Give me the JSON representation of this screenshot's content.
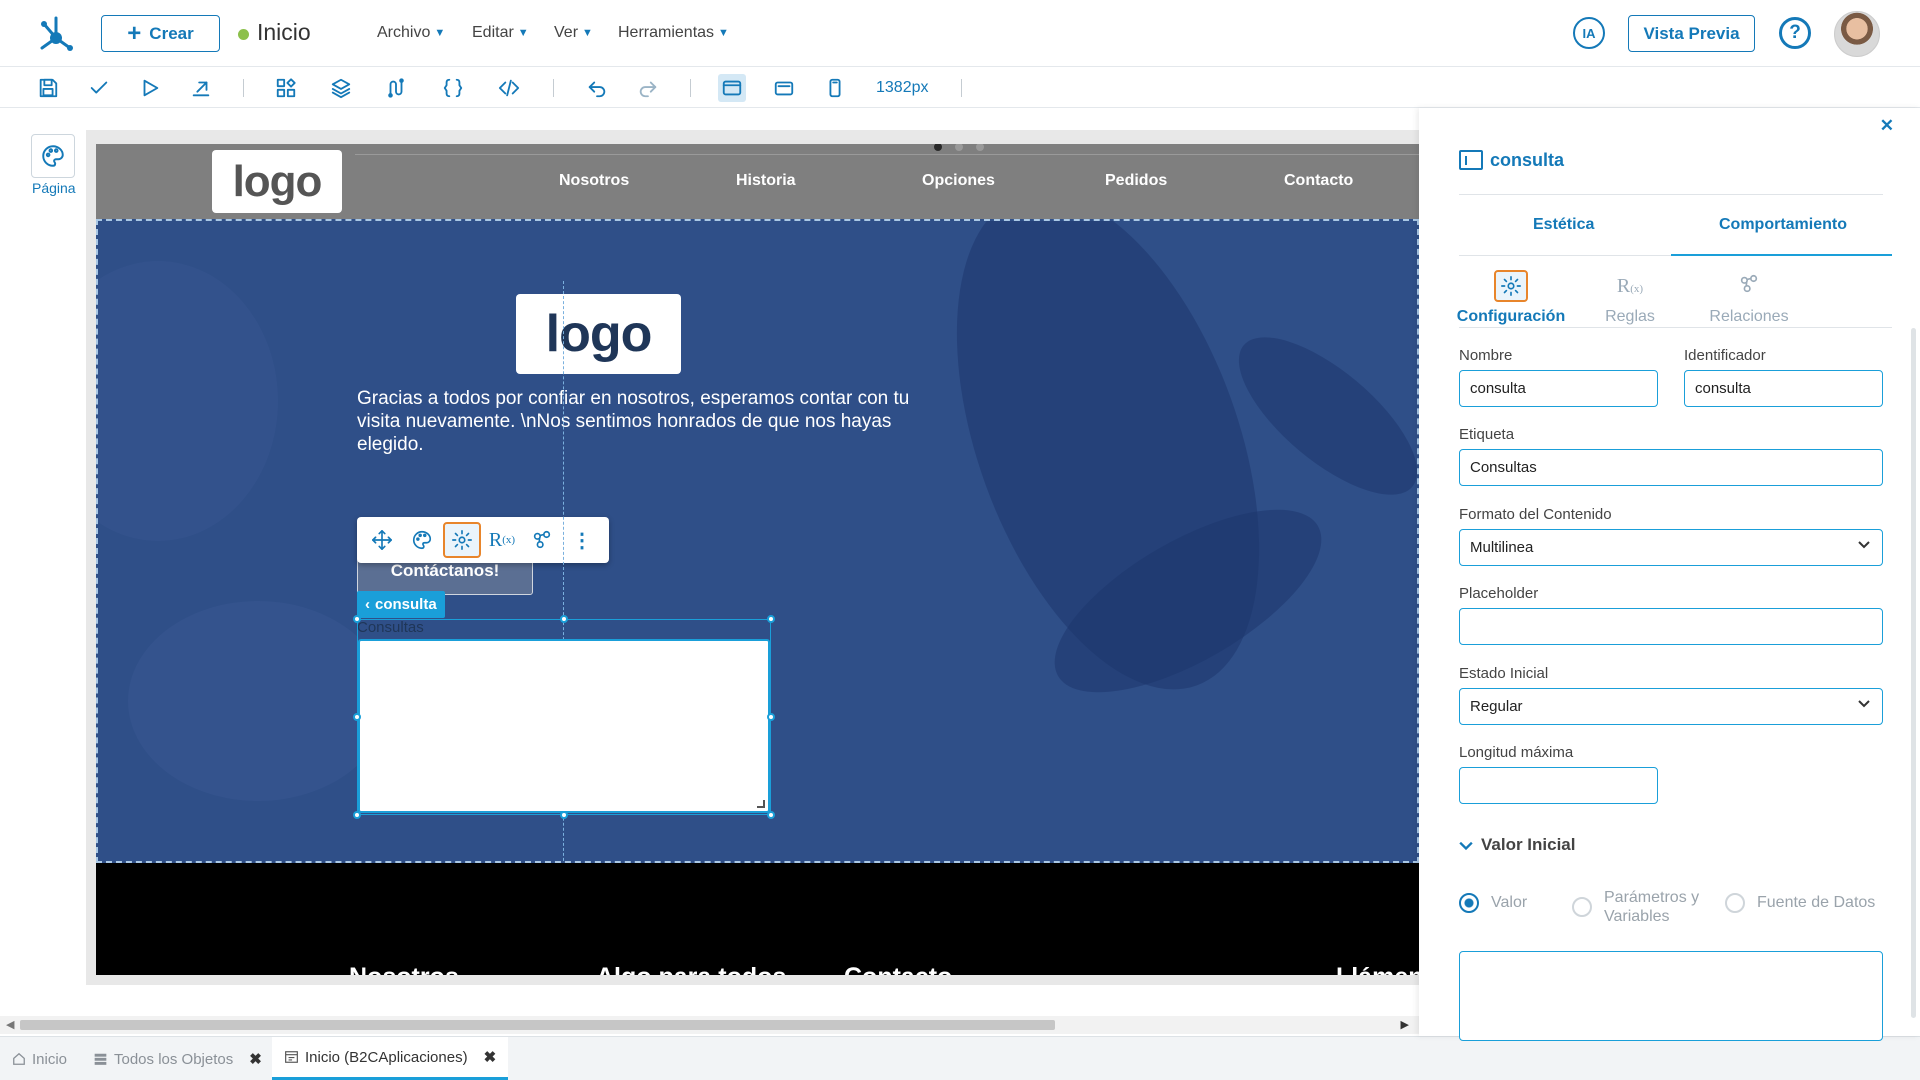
{
  "header": {
    "create_label": "Crear",
    "page_title": "Inicio",
    "menus": [
      "Archivo",
      "Editar",
      "Ver",
      "Herramientas"
    ],
    "ia_label": "IA",
    "preview_label": "Vista Previa",
    "help_label": "?"
  },
  "toolbar": {
    "width_value": "1382px"
  },
  "left_rail": {
    "page_label": "Página"
  },
  "site": {
    "logo_text": "logo",
    "nav": [
      "Nosotros",
      "Historia",
      "Opciones",
      "Pedidos",
      "Contacto"
    ],
    "hero_logo": "logo",
    "hero_text": "Gracias a todos por confiar en nosotros, esperamos contar con tu visita nuevamente. \\nNos sentimos honrados de que nos hayas elegido.",
    "contact_button": "Contáctanos!",
    "selected_badge": "consulta",
    "textarea_label": "Consultas",
    "footer_cols": [
      "Nosotros",
      "Algo para todos",
      "Contacto",
      "Llámen"
    ]
  },
  "bottom_tabs": [
    {
      "label": "Inicio"
    },
    {
      "label": "Todos los Objetos"
    },
    {
      "label": "Inicio (B2CAplicaciones)"
    }
  ],
  "panel": {
    "title": "consulta",
    "tab_aesthetic": "Estética",
    "tab_behavior": "Comportamiento",
    "subtabs": [
      "Configuración",
      "Reglas",
      "Relaciones"
    ],
    "fields": {
      "nombre_label": "Nombre",
      "nombre_value": "consulta",
      "identificador_label": "Identificador",
      "identificador_value": "consulta",
      "etiqueta_label": "Etiqueta",
      "etiqueta_value": "Consultas",
      "formato_label": "Formato del Contenido",
      "formato_value": "Multilinea",
      "placeholder_label": "Placeholder",
      "placeholder_value": "",
      "estado_label": "Estado Inicial",
      "estado_value": "Regular",
      "longitud_label": "Longitud máxima",
      "longitud_value": ""
    },
    "section_title": "Valor Inicial",
    "radios": [
      "Valor",
      "Parámetros y Variables",
      "Fuente de Datos"
    ],
    "radio_selected": "Valor"
  },
  "colors": {
    "accent": "#1479b8",
    "highlight": "#e8852b",
    "selection": "#1a9fd9",
    "hero_bg": "#2f4f88",
    "status_dot": "#8cc04b"
  }
}
